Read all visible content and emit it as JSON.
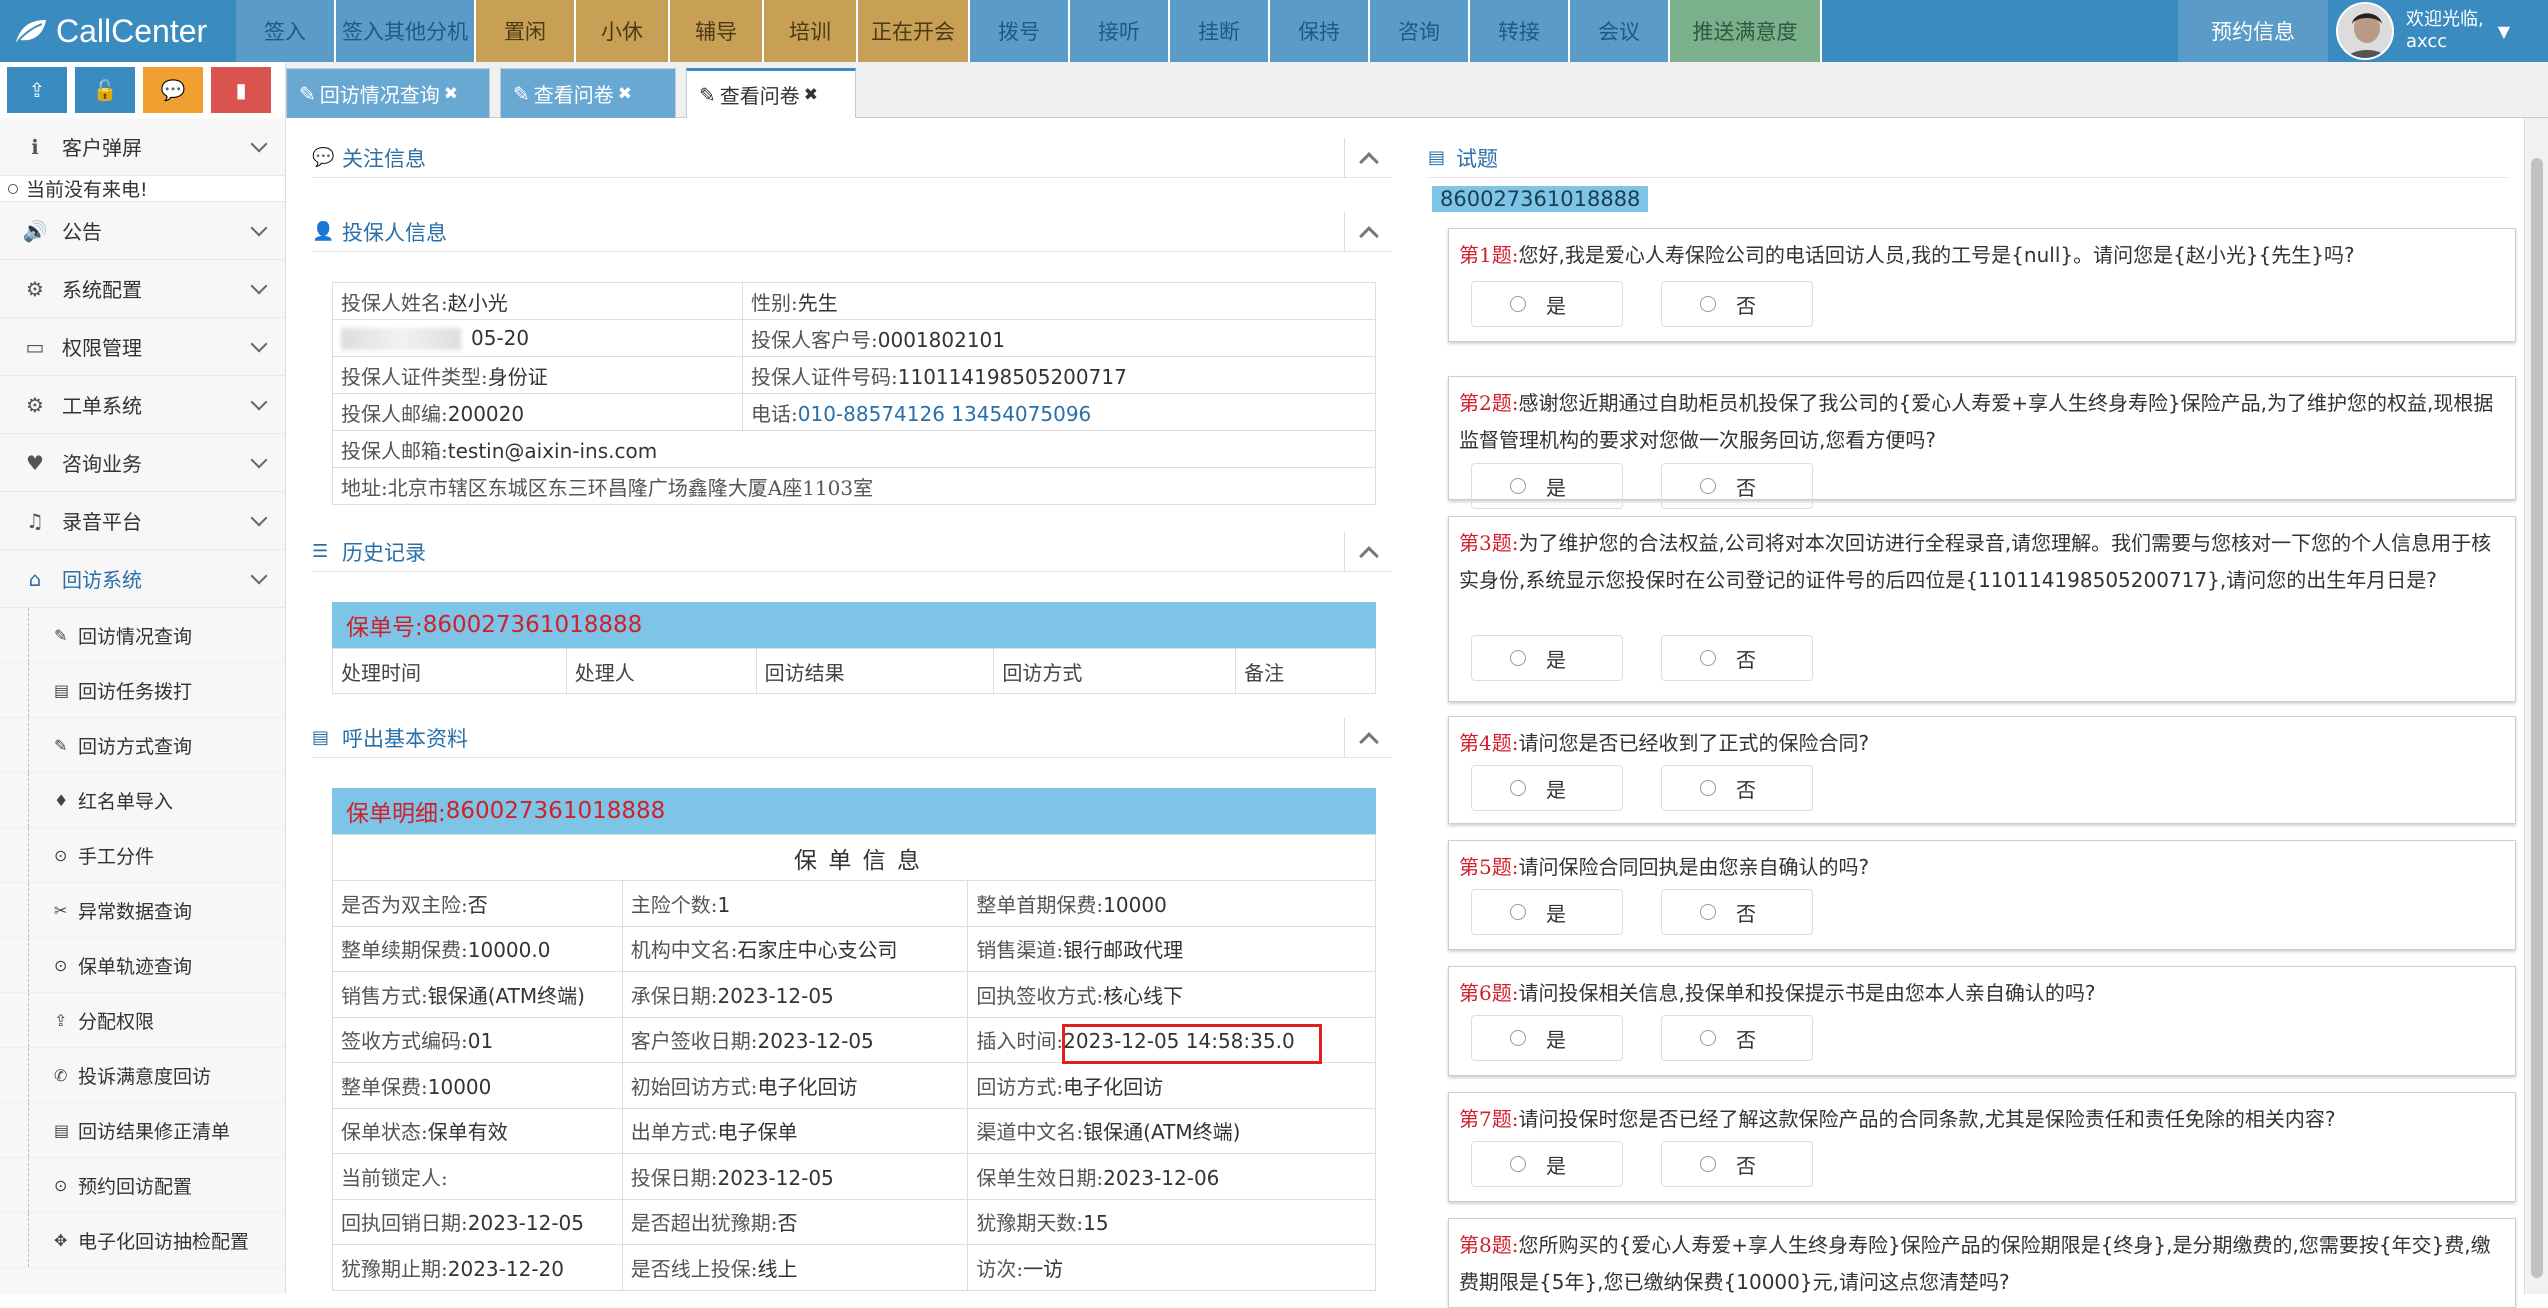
{
  "app": {
    "brand": "CallCenter"
  },
  "nav": [
    {
      "label": "签入",
      "style": "blue"
    },
    {
      "label": "签入其他分机",
      "style": "blue"
    },
    {
      "label": "置闲",
      "style": "gold"
    },
    {
      "label": "小休",
      "style": "gold"
    },
    {
      "label": "辅导",
      "style": "gold"
    },
    {
      "label": "培训",
      "style": "gold"
    },
    {
      "label": "正在开会",
      "style": "gold"
    },
    {
      "label": "拨号",
      "style": "blue"
    },
    {
      "label": "接听",
      "style": "blue"
    },
    {
      "label": "挂断",
      "style": "blue"
    },
    {
      "label": "保持",
      "style": "blue"
    },
    {
      "label": "咨询",
      "style": "blue"
    },
    {
      "label": "转接",
      "style": "blue"
    },
    {
      "label": "会议",
      "style": "blue"
    },
    {
      "label": "推送满意度",
      "style": "green"
    }
  ],
  "header_right": {
    "appoint": "预约信息",
    "welcome": "欢迎光临,",
    "user": "axcc",
    "caret": "▼"
  },
  "toolbar": {
    "buttons": [
      {
        "icon": "external-link-icon",
        "glyph": "⇪",
        "color": "#3a8cc0"
      },
      {
        "icon": "unlock-icon",
        "glyph": "🔓",
        "color": "#3a8cc0"
      },
      {
        "icon": "comments-icon",
        "glyph": "💬",
        "color": "#f0a030"
      },
      {
        "icon": "book-icon",
        "glyph": "▮",
        "color": "#d9534f"
      }
    ]
  },
  "tabs": [
    {
      "label": "回访情况查询",
      "state": "inactive",
      "close": "✖",
      "icon": "✎"
    },
    {
      "label": "查看问卷",
      "state": "inactive",
      "close": "✖",
      "icon": "✎"
    },
    {
      "label": "查看问卷",
      "state": "active",
      "close": "✖",
      "icon": "✎"
    }
  ],
  "sidebar": {
    "top_items": [
      {
        "label": "客户弹屏",
        "icon": "info-icon",
        "glyph": "ℹ"
      }
    ],
    "no_call": "当前没有来电!",
    "items": [
      {
        "label": "公告",
        "icon": "volume-icon",
        "glyph": "🔊"
      },
      {
        "label": "系统配置",
        "icon": "gears-icon",
        "glyph": "⚙"
      },
      {
        "label": "权限管理",
        "icon": "credit-card-icon",
        "glyph": "▭"
      },
      {
        "label": "工单系统",
        "icon": "gears-icon",
        "glyph": "⚙"
      },
      {
        "label": "咨询业务",
        "icon": "heart-icon",
        "glyph": "♥"
      },
      {
        "label": "录音平台",
        "icon": "music-icon",
        "glyph": "♫"
      },
      {
        "label": "回访系统",
        "icon": "home-icon",
        "glyph": "⌂"
      }
    ],
    "sub_items": [
      {
        "label": "回访情况查询",
        "glyph": "✎"
      },
      {
        "label": "回访任务拨打",
        "glyph": "▤"
      },
      {
        "label": "回访方式查询",
        "glyph": "✎"
      },
      {
        "label": "红名单导入",
        "glyph": "♦"
      },
      {
        "label": "手工分件",
        "glyph": "⊙"
      },
      {
        "label": "异常数据查询",
        "glyph": "✂"
      },
      {
        "label": "保单轨迹查询",
        "glyph": "⊙"
      },
      {
        "label": "分配权限",
        "glyph": "⇪"
      },
      {
        "label": "投诉满意度回访",
        "glyph": "✆"
      },
      {
        "label": "回访结果修正清单",
        "glyph": "▤"
      },
      {
        "label": "预约回访配置",
        "glyph": "⊙"
      },
      {
        "label": "电子化回访抽检配置",
        "glyph": "✥"
      }
    ]
  },
  "follow_section": {
    "title": "关注信息"
  },
  "holder_section": {
    "title": "投保人信息",
    "rows": [
      {
        "l": "投保人姓名:",
        "lv": "赵小光",
        "r": "性别:",
        "rv": "先生"
      },
      {
        "l": "",
        "lv": "05-20",
        "r": "投保人客户号:",
        "rv": "0001802101"
      },
      {
        "l": "投保人证件类型:",
        "lv": "身份证",
        "r": "投保人证件号码:",
        "rv": "110114198505200717"
      },
      {
        "l": "投保人邮编:",
        "lv": "200020",
        "r": "电话:",
        "rv": "010-88574126 13454075096"
      }
    ],
    "email_label": "投保人邮箱:",
    "email": "testin@aixin-ins.com",
    "address_label": "地址:",
    "address": "北京市辖区东城区东三环昌隆广场鑫隆大厦A座1103室"
  },
  "history_section": {
    "title": "历史记录",
    "policy_label": "保单号:",
    "policy_no": "860027361018888",
    "columns": [
      "处理时间",
      "处理人",
      "回访结果",
      "回访方式",
      "备注"
    ]
  },
  "call_section": {
    "title": "呼出基本资料",
    "detail_label": "保单明细:",
    "policy_no": "860027361018888",
    "table_title": "保 单 信 息",
    "rows": [
      [
        [
          "是否为双主险:",
          "否"
        ],
        [
          "主险个数:",
          "1"
        ],
        [
          "整单首期保费:",
          "10000"
        ]
      ],
      [
        [
          "整单续期保费:",
          "10000.0"
        ],
        [
          "机构中文名:",
          "石家庄中心支公司"
        ],
        [
          "销售渠道:",
          "银行邮政代理"
        ]
      ],
      [
        [
          "销售方式:",
          "银保通(ATM终端)"
        ],
        [
          "承保日期:",
          "2023-12-05"
        ],
        [
          "回执签收方式:",
          "核心线下"
        ]
      ],
      [
        [
          "签收方式编码:",
          "01"
        ],
        [
          "客户签收日期:",
          "2023-12-05"
        ],
        [
          "插入时间:",
          "2023-12-05 14:58:35.0"
        ]
      ],
      [
        [
          "整单保费:",
          "10000"
        ],
        [
          "初始回访方式:",
          "电子化回访"
        ],
        [
          "回访方式:",
          "电子化回访"
        ]
      ],
      [
        [
          "保单状态:",
          "保单有效"
        ],
        [
          "出单方式:",
          "电子保单"
        ],
        [
          "渠道中文名:",
          "银保通(ATM终端)"
        ]
      ],
      [
        [
          "当前锁定人:",
          ""
        ],
        [
          "投保日期:",
          "2023-12-05"
        ],
        [
          "保单生效日期:",
          "2023-12-06"
        ]
      ],
      [
        [
          "回执回销日期:",
          "2023-12-05"
        ],
        [
          "是否超出犹豫期:",
          "否"
        ],
        [
          "犹豫期天数:",
          "15"
        ]
      ],
      [
        [
          "犹豫期止期:",
          "2023-12-20"
        ],
        [
          "是否线上投保:",
          "线上"
        ],
        [
          "访次:",
          "一访"
        ]
      ]
    ]
  },
  "questions": {
    "title": "试题",
    "policy_tag": "860027361018888",
    "options": [
      "是",
      "否"
    ],
    "items": [
      {
        "num": "第1题:",
        "text": "您好,我是爱心人寿保险公司的电话回访人员,我的工号是{null}。请问您是{赵小光}{先生}吗?"
      },
      {
        "num": "第2题:",
        "text": "感谢您近期通过自助柜员机投保了我公司的{爱心人寿爱+享人生终身寿险}保险产品,为了维护您的权益,现根据监督管理机构的要求对您做一次服务回访,您看方便吗?"
      },
      {
        "num": "第3题:",
        "text": "为了维护您的合法权益,公司将对本次回访进行全程录音,请您理解。我们需要与您核对一下您的个人信息用于核实身份,系统显示您投保时在公司登记的证件号的后四位是{110114198505200717},请问您的出生年月日是?"
      },
      {
        "num": "第4题:",
        "text": "请问您是否已经收到了正式的保险合同?"
      },
      {
        "num": "第5题:",
        "text": "请问保险合同回执是由您亲自确认的吗?"
      },
      {
        "num": "第6题:",
        "text": "请问投保相关信息,投保单和投保提示书是由您本人亲自确认的吗?"
      },
      {
        "num": "第7题:",
        "text": "请问投保时您是否已经了解这款保险产品的合同条款,尤其是保险责任和责任免除的相关内容?"
      },
      {
        "num": "第8题:",
        "text": "您所购买的{爱心人寿爱+享人生终身寿险}保险产品的保险期限是{终身},是分期缴费的,您需要按{年交}费,缴费期限是{5年},您已缴纳保费{10000}元,请问这点您清楚吗?"
      }
    ]
  }
}
